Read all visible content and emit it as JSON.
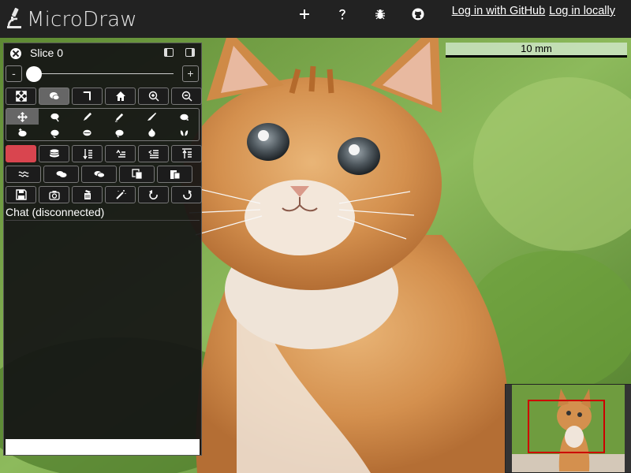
{
  "app": {
    "title": "MicroDraw",
    "logo_icon": "microscope-icon"
  },
  "header": {
    "icons": [
      {
        "name": "add-icon",
        "glyph": "+"
      },
      {
        "name": "help-icon",
        "glyph": "?"
      },
      {
        "name": "bug-icon",
        "glyph": "bug"
      },
      {
        "name": "github-icon",
        "glyph": "github"
      }
    ],
    "login_github": "Log in with GitHub",
    "login_local": "Log in locally"
  },
  "viewer": {
    "scalebar_label": "10 mm",
    "navigator_border_color": "#cc0000"
  },
  "panel": {
    "slice_title": "Slice 0",
    "slider": {
      "minus": "-",
      "plus": "+",
      "value": 0
    },
    "nav_tools": [
      {
        "name": "fullscreen-icon",
        "active": false
      },
      {
        "name": "chat-bubble-icon",
        "active": true
      },
      {
        "name": "script-icon",
        "active": false
      },
      {
        "name": "home-icon",
        "active": false
      },
      {
        "name": "zoom-in-icon",
        "active": false
      },
      {
        "name": "zoom-out-icon",
        "active": false
      }
    ],
    "draw_tools_row1": [
      {
        "name": "move-icon",
        "active": true
      },
      {
        "name": "select-icon",
        "active": false
      },
      {
        "name": "draw-icon",
        "active": false
      },
      {
        "name": "draw-polygon-icon",
        "active": false
      },
      {
        "name": "pen-icon",
        "active": false
      },
      {
        "name": "rotate-icon",
        "active": false
      }
    ],
    "draw_tools_row2": [
      {
        "name": "add-point-icon",
        "active": false
      },
      {
        "name": "delete-point-icon",
        "active": false
      },
      {
        "name": "simplify-icon",
        "active": false
      },
      {
        "name": "smooth-icon",
        "active": false
      },
      {
        "name": "flip-icon",
        "active": false
      },
      {
        "name": "split-icon",
        "active": false
      }
    ],
    "region_color": "#d9454f",
    "region_tools": [
      {
        "name": "color-swatch-icon"
      },
      {
        "name": "layers-icon"
      },
      {
        "name": "sort-ascending-icon"
      },
      {
        "name": "sort-descending-icon"
      },
      {
        "name": "indent-less-icon"
      },
      {
        "name": "to-top-icon"
      }
    ],
    "edit_tools": [
      {
        "name": "wave-icon"
      },
      {
        "name": "union-icon"
      },
      {
        "name": "intersect-icon"
      },
      {
        "name": "copy-icon"
      },
      {
        "name": "paste-icon"
      }
    ],
    "file_tools": [
      {
        "name": "save-icon"
      },
      {
        "name": "screenshot-icon"
      },
      {
        "name": "clear-icon"
      },
      {
        "name": "magic-wand-icon"
      },
      {
        "name": "undo-icon"
      },
      {
        "name": "redo-icon"
      }
    ],
    "chat_label": "Chat (disconnected)",
    "chat_input_value": ""
  }
}
